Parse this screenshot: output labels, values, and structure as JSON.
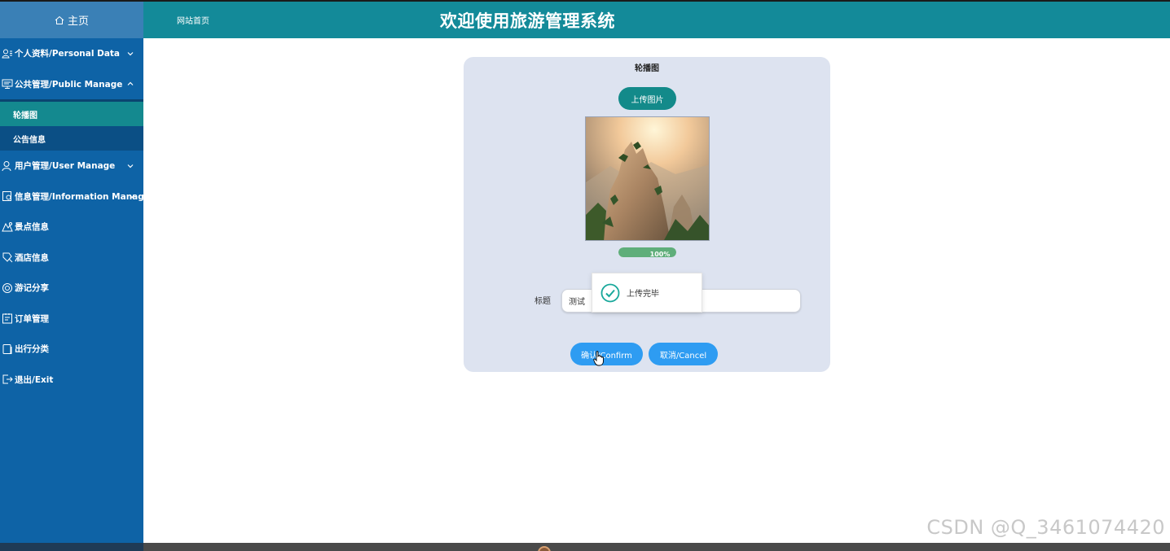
{
  "sidebar": {
    "home_label": "主页",
    "items": [
      {
        "label": "个人资料/Personal Data",
        "icon": "user-card-icon",
        "expandable": true
      },
      {
        "label": "公共管理/Public Manage",
        "icon": "monitor-icon",
        "expandable": true,
        "expanded": true,
        "children": [
          {
            "label": "轮播图",
            "active": true
          },
          {
            "label": "公告信息",
            "active": false
          }
        ]
      },
      {
        "label": "用户管理/User Manage",
        "icon": "user-icon",
        "expandable": true
      },
      {
        "label": "信息管理/Information Manage",
        "icon": "info-settings-icon",
        "expandable": true
      },
      {
        "label": "景点信息",
        "icon": "scenic-icon"
      },
      {
        "label": "酒店信息",
        "icon": "hotel-icon"
      },
      {
        "label": "游记分享",
        "icon": "share-icon"
      },
      {
        "label": "订单管理",
        "icon": "order-icon"
      },
      {
        "label": "出行分类",
        "icon": "category-icon"
      },
      {
        "label": "退出/Exit",
        "icon": "exit-icon"
      }
    ]
  },
  "header": {
    "site_link": "网站首页",
    "title": "欢迎使用旅游管理系统"
  },
  "form": {
    "section_title": "轮播图",
    "upload_label": "上传图片",
    "progress_text": "100%",
    "progress_value": 1.0,
    "title_label": "标题",
    "title_value": "测试",
    "confirm_label": "确认/Confirm",
    "cancel_label": "取消/Cancel"
  },
  "toast": {
    "message": "上传完毕"
  },
  "watermark": "CSDN @Q_3461074420",
  "colors": {
    "sidebar": "#0e63a6",
    "header": "#138a99",
    "active_item": "#14898f",
    "primary_button": "#2e9cf2",
    "success": "#19a89b"
  }
}
